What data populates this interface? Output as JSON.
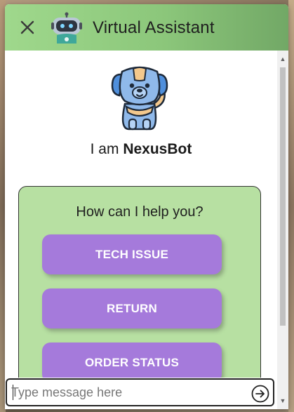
{
  "header": {
    "title": "Virtual Assistant",
    "close_icon": "close-icon",
    "avatar_icon": "robot-avatar-icon",
    "bg_color": "#8cc77b"
  },
  "intro": {
    "prefix": "I am ",
    "bot_name": "NexusBot",
    "mascot_icon": "dog-mascot-icon"
  },
  "panel": {
    "title": "How can I help you?",
    "bg_color": "#b7e0a2",
    "options": [
      {
        "label": "TECH ISSUE"
      },
      {
        "label": "RETURN"
      },
      {
        "label": "ORDER STATUS"
      }
    ],
    "option_color": "#a57adb"
  },
  "composer": {
    "placeholder": "Type message here",
    "value": "",
    "send_icon": "send-arrow-icon"
  }
}
